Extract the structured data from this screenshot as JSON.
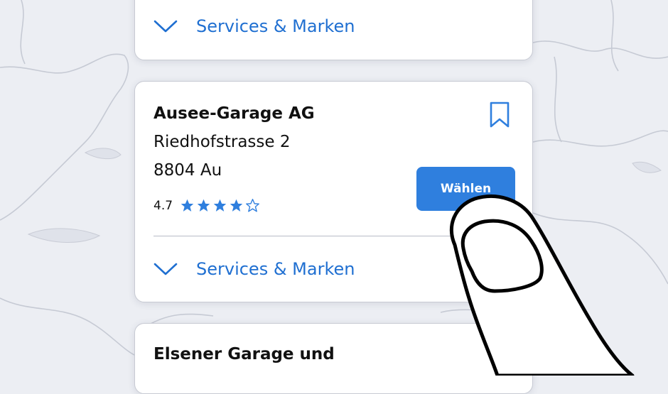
{
  "cards": [
    {
      "services_label": "Services & Marken"
    },
    {
      "name": "Ausee-Garage AG",
      "street": "Riedhofstrasse 2",
      "city": "8804 Au",
      "rating": "4.7",
      "stars_filled": 4,
      "stars_total": 5,
      "choose_label": "Wählen",
      "services_label": "Services & Marken"
    },
    {
      "name": "Elsener Garage und"
    }
  ],
  "icons": {
    "expand": "chevron-down-icon",
    "bookmark": "bookmark-icon",
    "star": "star-icon",
    "pointer": "finger-pointer-icon"
  },
  "colors": {
    "accent": "#2f7fde",
    "link": "#1f6fd1",
    "map_background": "#eceef3"
  }
}
